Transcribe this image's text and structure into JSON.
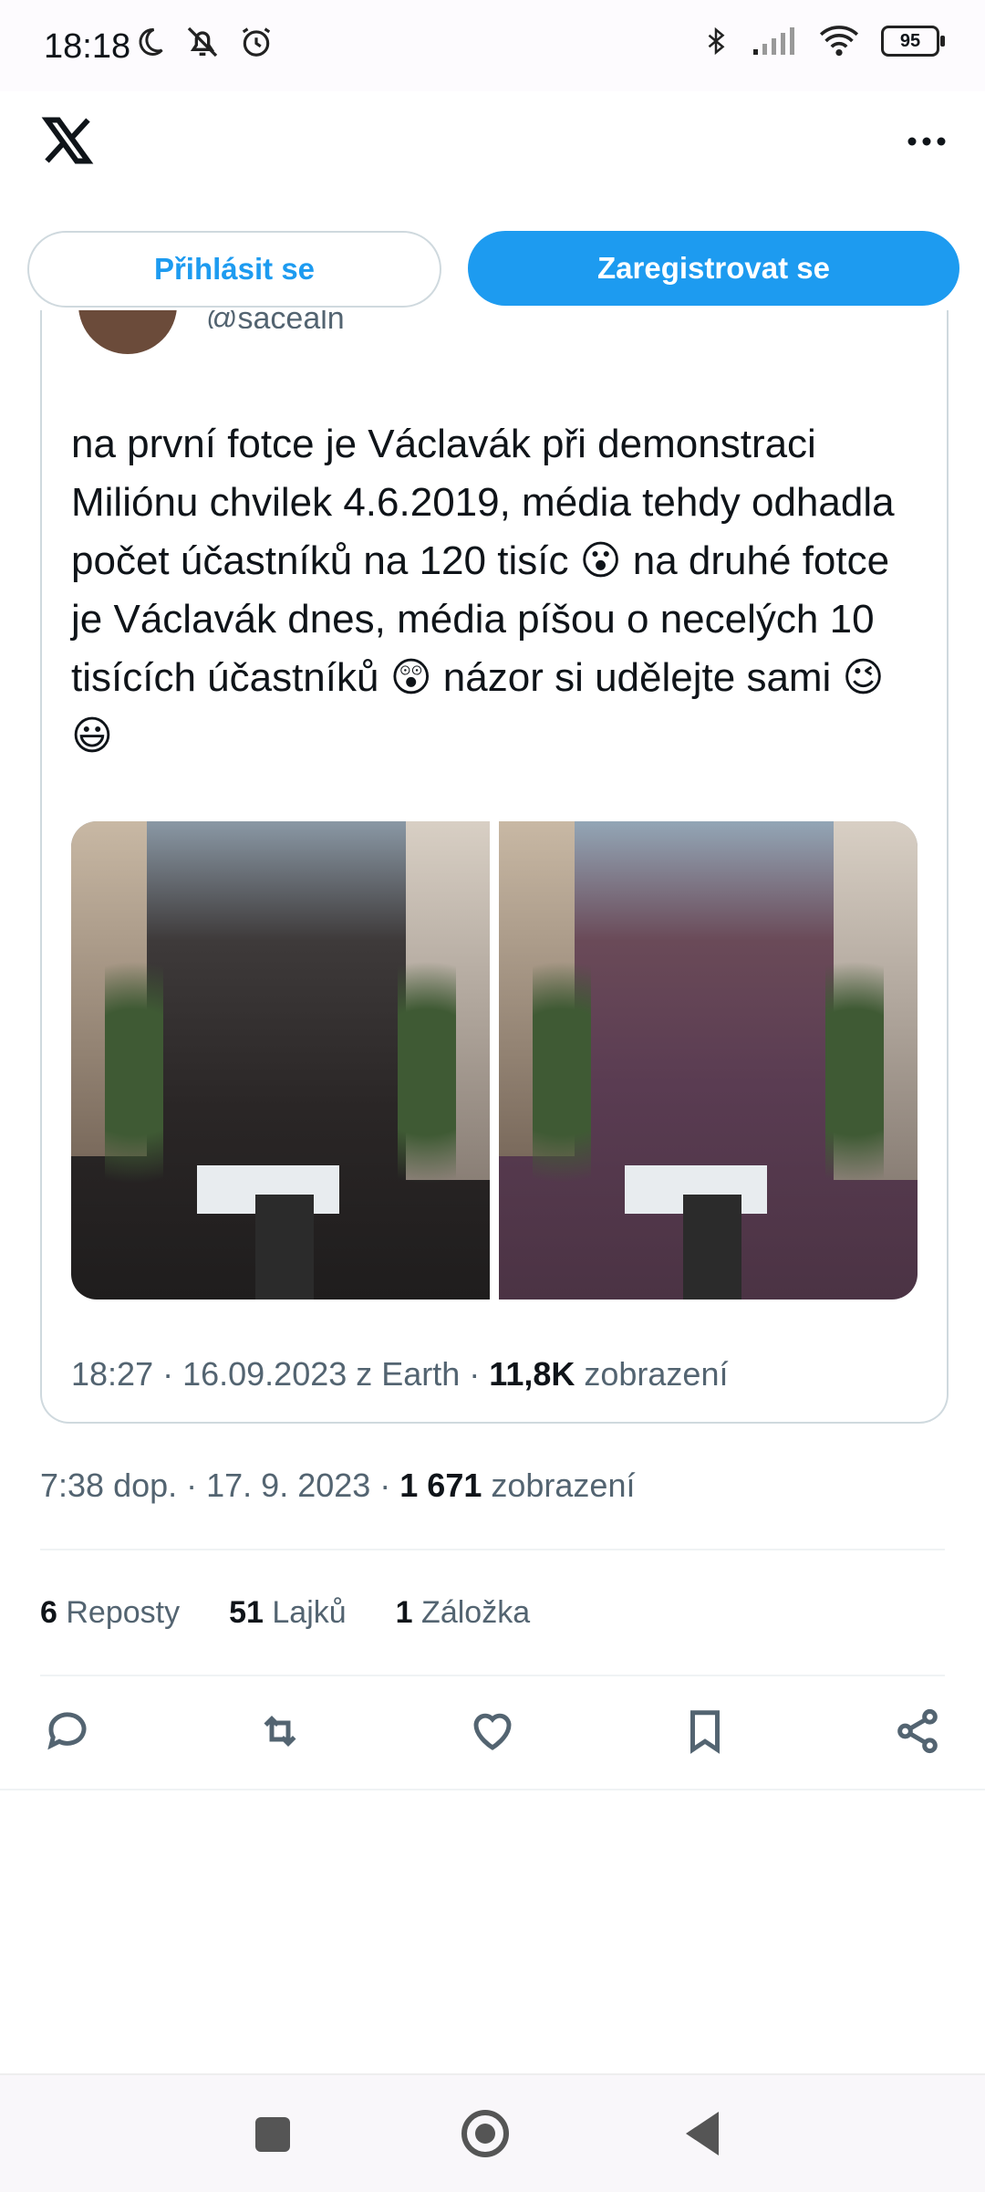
{
  "status_bar": {
    "time": "18:18",
    "battery": "95"
  },
  "auth": {
    "login_label": "Přihlásit se",
    "register_label": "Zaregistrovat se"
  },
  "quote": {
    "handle": "@sacealn",
    "text": "na první fotce je Václavák při demonstraci Miliónu chvilek 4.6.2019, média tehdy odhadla počet účastníků na 120 tisíc 😮 na druhé fotce je Václavák dnes, média píšou o necelých 10 tisících účastníků 😲 názor si udělejte sami 😉 😃",
    "meta_prefix": "18:27 · 16.09.2023 z Earth · ",
    "views_count": "11,8K",
    "views_label": " zobrazení"
  },
  "tweet": {
    "meta_prefix": "7:38 dop. · 17. 9. 2023 · ",
    "views_count": "1 671",
    "views_label": " zobrazení"
  },
  "stats": [
    {
      "count": "6",
      "label": "Reposty"
    },
    {
      "count": "51",
      "label": "Lajků"
    },
    {
      "count": "1",
      "label": "Záložka"
    }
  ],
  "icons": {
    "logo": "x-logo-icon",
    "more": "more-options-icon",
    "reply": "reply-icon",
    "repost": "repost-icon",
    "like": "heart-icon",
    "bookmark": "bookmark-icon",
    "share": "share-icon"
  },
  "colors": {
    "accent": "#1d9bf0",
    "secondary_text": "#536471"
  }
}
